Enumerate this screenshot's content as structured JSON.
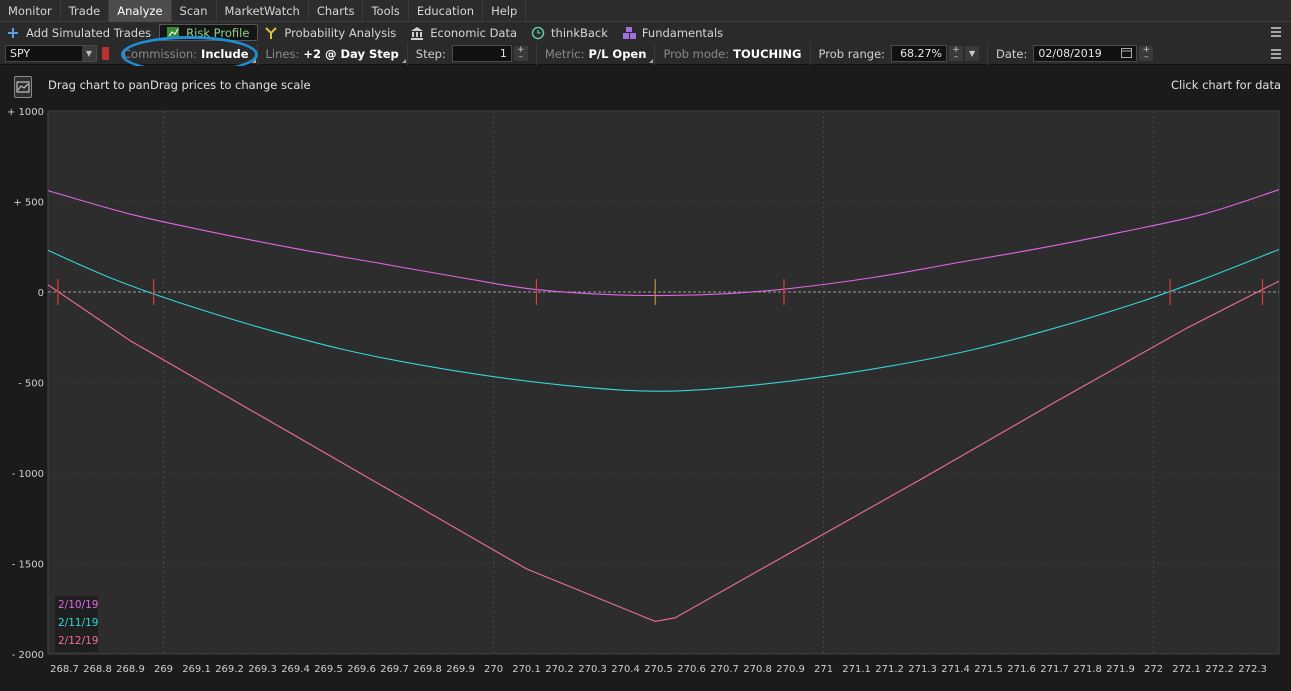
{
  "menu": [
    {
      "label": "Monitor",
      "active": false
    },
    {
      "label": "Trade",
      "active": false
    },
    {
      "label": "Analyze",
      "active": true
    },
    {
      "label": "Scan",
      "active": false
    },
    {
      "label": "MarketWatch",
      "active": false
    },
    {
      "label": "Charts",
      "active": false
    },
    {
      "label": "Tools",
      "active": false
    },
    {
      "label": "Education",
      "active": false
    },
    {
      "label": "Help",
      "active": false
    }
  ],
  "tools": {
    "add_simulated": "Add Simulated Trades",
    "risk_profile": "Risk Profile",
    "probability": "Probability Analysis",
    "economic": "Economic Data",
    "thinkback": "thinkBack",
    "fundamentals": "Fundamentals"
  },
  "settings": {
    "symbol": "SPY",
    "commission_label": "Commission:",
    "commission_value": "Include",
    "lines_label": "Lines:",
    "lines_value": "+2 @ Day Step",
    "step_label": "Step:",
    "step_value": "1",
    "metric_label": "Metric:",
    "metric_value": "P/L Open",
    "probmode_label": "Prob mode:",
    "probmode_value": "TOUCHING",
    "probrange_label": "Prob range:",
    "probrange_value": "68.27%",
    "date_label": "Date:",
    "date_value": "02/08/2019"
  },
  "chart_head": {
    "hint": "Drag chart to panDrag prices to change scale",
    "hint_right": "Click chart for data"
  },
  "colors": {
    "line_2_10": "#e066e6",
    "line_2_11": "#33d6d6",
    "line_2_12": "#ef6f98",
    "breakeven": "#e23b3b",
    "highlight": "#1e8fd6"
  },
  "chart_data": {
    "type": "line",
    "xlim": [
      268.65,
      272.38
    ],
    "ylim": [
      -2000,
      1000
    ],
    "y_ticks": [
      {
        "v": 1000,
        "label": "+ 1000"
      },
      {
        "v": 500,
        "label": "+ 500"
      },
      {
        "v": 0,
        "label": "0"
      },
      {
        "v": -500,
        "label": "- 500"
      },
      {
        "v": -1000,
        "label": "- 1000"
      },
      {
        "v": -1500,
        "label": "- 1500"
      },
      {
        "v": -2000,
        "label": "- 2000"
      }
    ],
    "x_ticks": [
      "268.7",
      "268.8",
      "268.9",
      "269",
      "269.1",
      "269.2",
      "269.3",
      "269.4",
      "269.5",
      "269.6",
      "269.7",
      "269.8",
      "269.9",
      "270",
      "270.1",
      "270.2",
      "270.3",
      "270.4",
      "270.5",
      "270.6",
      "270.7",
      "270.8",
      "270.9",
      "271",
      "271.1",
      "271.2",
      "271.3",
      "271.4",
      "271.5",
      "271.6",
      "271.7",
      "271.8",
      "271.9",
      "272",
      "272.1",
      "272.2",
      "272.3"
    ],
    "series": [
      {
        "name": "2/10/19",
        "points": [
          [
            268.65,
            560
          ],
          [
            268.9,
            430
          ],
          [
            269.15,
            330
          ],
          [
            269.4,
            240
          ],
          [
            269.65,
            160
          ],
          [
            269.9,
            80
          ],
          [
            270.1,
            20
          ],
          [
            270.3,
            -10
          ],
          [
            270.5,
            -20
          ],
          [
            270.7,
            -10
          ],
          [
            270.9,
            20
          ],
          [
            271.15,
            80
          ],
          [
            271.4,
            160
          ],
          [
            271.65,
            240
          ],
          [
            271.9,
            330
          ],
          [
            272.15,
            430
          ],
          [
            272.38,
            565
          ]
        ]
      },
      {
        "name": "2/11/19",
        "points": [
          [
            268.65,
            230
          ],
          [
            268.85,
            70
          ],
          [
            269.05,
            -60
          ],
          [
            269.3,
            -200
          ],
          [
            269.55,
            -320
          ],
          [
            269.8,
            -410
          ],
          [
            270.05,
            -480
          ],
          [
            270.3,
            -530
          ],
          [
            270.5,
            -548
          ],
          [
            270.7,
            -530
          ],
          [
            270.95,
            -480
          ],
          [
            271.2,
            -410
          ],
          [
            271.45,
            -320
          ],
          [
            271.7,
            -200
          ],
          [
            271.95,
            -60
          ],
          [
            272.15,
            70
          ],
          [
            272.38,
            235
          ]
        ]
      },
      {
        "name": "2/12/19",
        "points": [
          [
            268.65,
            40
          ],
          [
            268.9,
            -270
          ],
          [
            269.3,
            -690
          ],
          [
            269.7,
            -1110
          ],
          [
            270.1,
            -1530
          ],
          [
            270.49,
            -1820
          ],
          [
            270.55,
            -1800
          ],
          [
            270.9,
            -1440
          ],
          [
            271.3,
            -1030
          ],
          [
            271.7,
            -610
          ],
          [
            272.1,
            -200
          ],
          [
            272.38,
            60
          ]
        ]
      }
    ],
    "breakevens": [
      {
        "x": 268.68,
        "color": "#e23b3b"
      },
      {
        "x": 268.97,
        "color": "#e23b3b"
      },
      {
        "x": 270.13,
        "color": "#e23b3b"
      },
      {
        "x": 270.49,
        "color": "#c08a3a"
      },
      {
        "x": 270.88,
        "color": "#e23b3b"
      },
      {
        "x": 272.05,
        "color": "#e23b3b"
      },
      {
        "x": 272.33,
        "color": "#e23b3b"
      }
    ]
  }
}
